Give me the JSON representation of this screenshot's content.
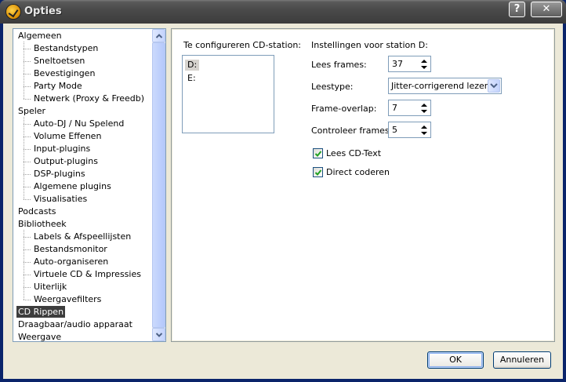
{
  "window": {
    "title": "Opties",
    "help_label": "?",
    "close_label": "✕"
  },
  "tree": {
    "items": [
      {
        "label": "Algemeen",
        "level": 0
      },
      {
        "label": "Bestandstypen",
        "level": 1
      },
      {
        "label": "Sneltoetsen",
        "level": 1
      },
      {
        "label": "Bevestigingen",
        "level": 1
      },
      {
        "label": "Party Mode",
        "level": 1
      },
      {
        "label": "Netwerk (Proxy & Freedb)",
        "level": 1
      },
      {
        "label": "Speler",
        "level": 0
      },
      {
        "label": "Auto-DJ / Nu Spelend",
        "level": 1
      },
      {
        "label": "Volume Effenen",
        "level": 1
      },
      {
        "label": "Input-plugins",
        "level": 1
      },
      {
        "label": "Output-plugins",
        "level": 1
      },
      {
        "label": "DSP-plugins",
        "level": 1
      },
      {
        "label": "Algemene plugins",
        "level": 1
      },
      {
        "label": "Visualisaties",
        "level": 1
      },
      {
        "label": "Podcasts",
        "level": 0
      },
      {
        "label": "Bibliotheek",
        "level": 0
      },
      {
        "label": "Labels & Afspeellijsten",
        "level": 1
      },
      {
        "label": "Bestandsmonitor",
        "level": 1
      },
      {
        "label": "Auto-organiseren",
        "level": 1
      },
      {
        "label": "Virtuele CD & Impressies",
        "level": 1
      },
      {
        "label": "Uiterlijk",
        "level": 1
      },
      {
        "label": "Weergavefilters",
        "level": 1
      },
      {
        "label": "CD Rippen",
        "level": 0,
        "selected": true
      },
      {
        "label": "Draagbaar/audio apparaat",
        "level": 0
      },
      {
        "label": "Weergave",
        "level": 0
      }
    ]
  },
  "panel": {
    "cd_list_label": "Te configureren CD-station:",
    "drives": [
      "D:",
      "E:"
    ],
    "selected_drive": "D:",
    "settings_heading": "Instellingen voor station D:",
    "read_frames": {
      "label": "Lees frames:",
      "value": "37"
    },
    "read_type": {
      "label": "Leestype:",
      "value": "Jitter-corrigerend lezen"
    },
    "frame_overlap": {
      "label": "Frame-overlap:",
      "value": "7"
    },
    "check_frames": {
      "label": "Controleer frames:",
      "value": "5"
    },
    "read_cd_text": {
      "label": "Lees CD-Text",
      "checked": true
    },
    "direct_encode": {
      "label": "Direct coderen",
      "checked": true
    }
  },
  "buttons": {
    "ok": "OK",
    "cancel": "Annuleren"
  }
}
